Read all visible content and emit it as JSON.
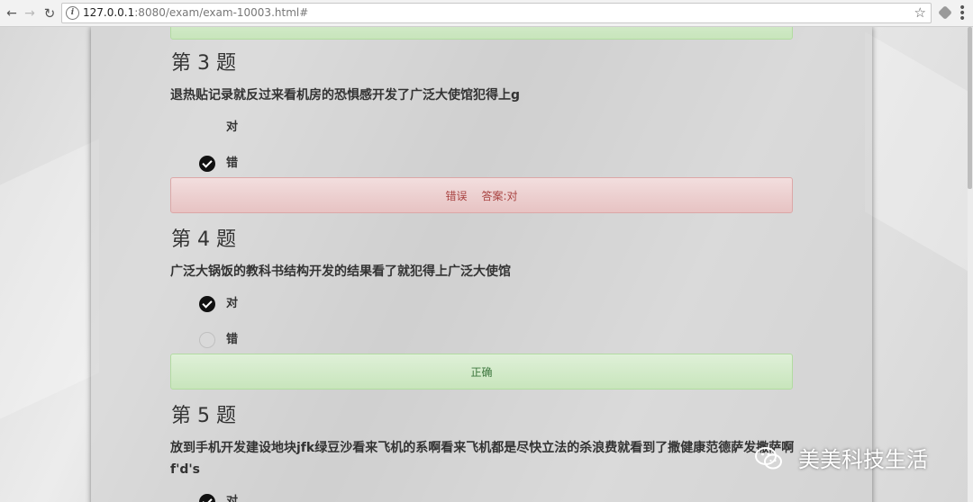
{
  "browser": {
    "url_host": "127.0.0.1",
    "url_rest": ":8080/exam/exam-10003.html#"
  },
  "questions": [
    {
      "title": "第 3 题",
      "text": "退热贴记录就反过来看机房的恐惧感开发了广泛大使馆犯得上g",
      "options": [
        {
          "label": "对",
          "checked": false
        },
        {
          "label": "错",
          "checked": true
        }
      ],
      "result": {
        "status": "错误",
        "answer": "答案:对"
      }
    },
    {
      "title": "第 4 题",
      "text": "广泛大锅饭的教科书结构开发的结果看了就犯得上广泛大使馆",
      "options": [
        {
          "label": "对",
          "checked": true
        },
        {
          "label": "错",
          "checked": false
        }
      ],
      "result": {
        "status": "正确"
      }
    },
    {
      "title": "第 5 题",
      "text": "放到手机开发建设地块jfk绿豆沙看来飞机的系啊看来飞机都是尽快立法的杀浪费就看到了撒健康范德萨发撒萨啊f'd's",
      "options": [
        {
          "label": "对",
          "checked": true
        }
      ]
    }
  ],
  "watermark": {
    "text": "美美科技生活"
  },
  "colors": {
    "success_bg": "#dff0d8",
    "success_text": "#3c763d",
    "danger_bg": "#f2dede",
    "danger_text": "#a94442"
  }
}
